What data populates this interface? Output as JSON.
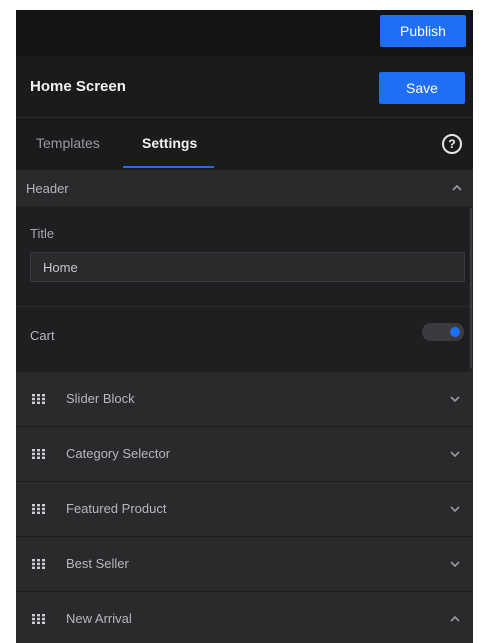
{
  "topbar": {
    "publish_label": "Publish"
  },
  "titlebar": {
    "title": "Home Screen",
    "save_label": "Save"
  },
  "tabs": [
    {
      "label": "Templates",
      "active": false
    },
    {
      "label": "Settings",
      "active": true
    }
  ],
  "help": {
    "glyph": "?",
    "icon": "help-circle-icon"
  },
  "header_section": {
    "label": "Header",
    "expanded": true,
    "title_field": {
      "label": "Title",
      "value": "Home"
    },
    "cart": {
      "label": "Cart",
      "enabled": true
    }
  },
  "blocks": [
    {
      "label": "Slider Block",
      "expanded": false
    },
    {
      "label": "Category Selector",
      "expanded": false
    },
    {
      "label": "Featured Product",
      "expanded": false
    },
    {
      "label": "Best Seller",
      "expanded": false
    },
    {
      "label": "New Arrival",
      "expanded": true
    }
  ],
  "colors": {
    "accent": "#1f6ff5",
    "panel_bg": "#1b1b1d",
    "section_bg": "#2a2a2d"
  }
}
